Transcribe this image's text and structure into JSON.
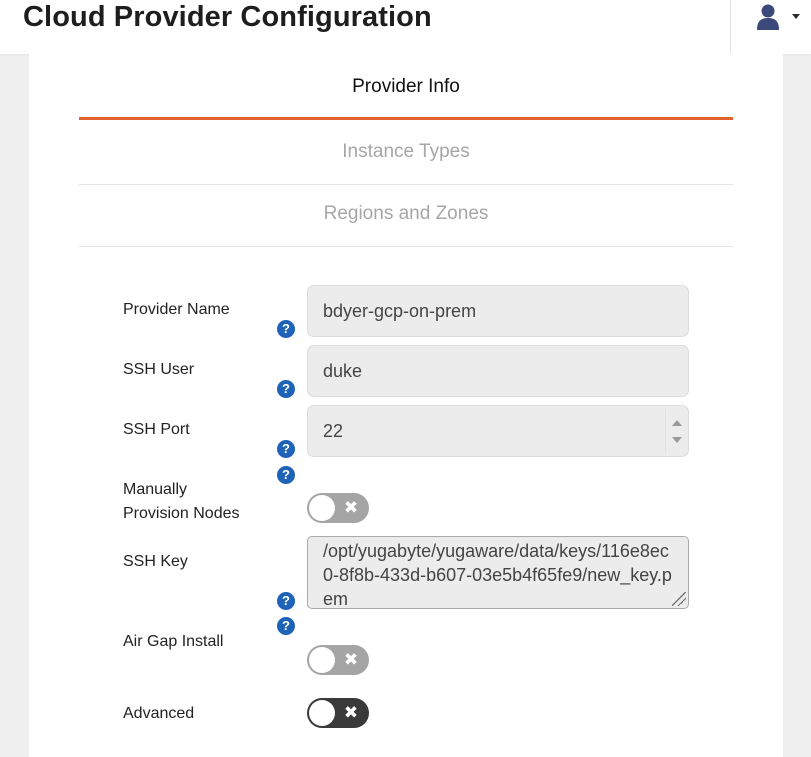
{
  "header": {
    "title": "Cloud Provider Configuration",
    "user_icon": "user-icon",
    "caret_icon": "caret-down-icon"
  },
  "tabs": [
    {
      "label": "Provider Info",
      "active": true
    },
    {
      "label": "Instance Types",
      "active": false
    },
    {
      "label": "Regions and Zones",
      "active": false
    }
  ],
  "form": {
    "provider_name": {
      "label": "Provider Name",
      "value": "bdyer-gcp-on-prem"
    },
    "ssh_user": {
      "label": "SSH User",
      "value": "duke"
    },
    "ssh_port": {
      "label": "SSH Port",
      "value": "22"
    },
    "manually_provision": {
      "label_line1": "Manually",
      "label_line2": "Provision Nodes",
      "enabled": false
    },
    "ssh_key": {
      "label": "SSH Key",
      "value": "/opt/yugabyte/yugaware/data/keys/116e8ec0-8f8b-433d-b607-03e5b4f65fe9/new_key.pem"
    },
    "air_gap_install": {
      "label": "Air Gap Install",
      "enabled": false
    },
    "advanced": {
      "label": "Advanced",
      "enabled": false
    }
  },
  "help_glyph": "?",
  "toggle_off_glyph": "✖",
  "colors": {
    "accent": "#e0622f",
    "help_icon": "#1f63b8",
    "toggle_disabled": "#a5a5a5",
    "toggle_dark": "#3a3a3a"
  }
}
